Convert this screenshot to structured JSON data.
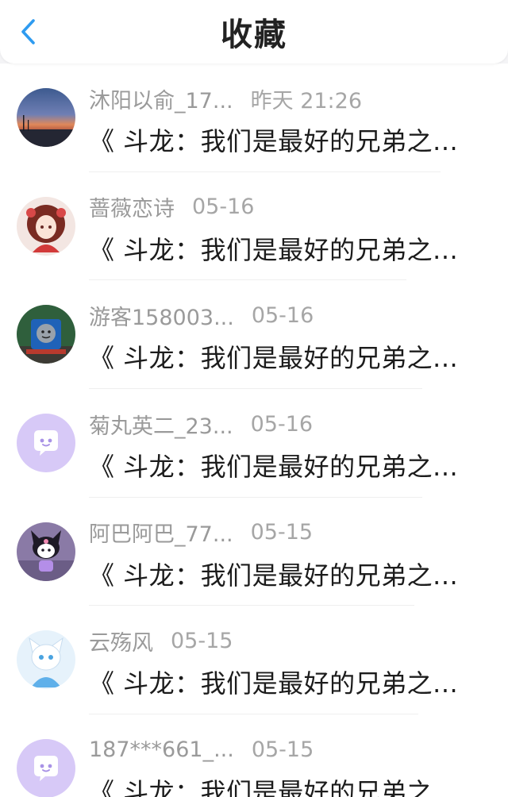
{
  "header": {
    "title": "收藏",
    "back_icon": "chevron-left-icon",
    "accent_color": "#2e9bf0"
  },
  "favorites": [
    {
      "name": "沐阳以俞_17...",
      "time": "昨天 21:26",
      "content": "《 斗龙：我们是最好的兄弟之...",
      "avatar": "sunset-landscape-avatar"
    },
    {
      "name": "蔷薇恋诗",
      "time": "05-16",
      "content": "《 斗龙：我们是最好的兄弟之...",
      "avatar": "anime-girl-avatar"
    },
    {
      "name": "游客158003...",
      "time": "05-16",
      "content": "《 斗龙：我们是最好的兄弟之...",
      "avatar": "train-avatar"
    },
    {
      "name": "菊丸英二_23...",
      "time": "05-16",
      "content": "《 斗龙：我们是最好的兄弟之...",
      "avatar": "default-chat-avatar"
    },
    {
      "name": "阿巴阿巴_77...",
      "time": "05-15",
      "content": "《 斗龙：我们是最好的兄弟之...",
      "avatar": "kuromi-avatar"
    },
    {
      "name": "云殇风",
      "time": "05-15",
      "content": "《 斗龙：我们是最好的兄弟之...",
      "avatar": "white-cat-girl-avatar"
    },
    {
      "name": "187***661_...",
      "time": "05-15",
      "content": "《 斗龙：我们是最好的兄弟之...",
      "avatar": "default-chat-avatar"
    }
  ]
}
